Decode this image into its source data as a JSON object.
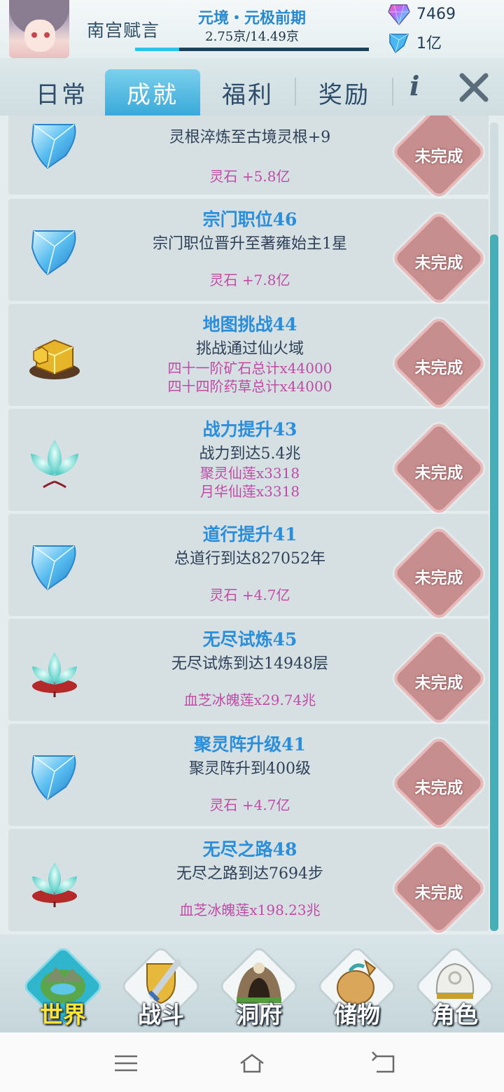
{
  "player": {
    "name": "南宫赋言",
    "realm": "元境・元极前期",
    "progress_text": "2.75京/14.49京",
    "progress_fraction": 0.19
  },
  "currency": {
    "gem": "7469",
    "crystal": "1亿"
  },
  "tabs": [
    {
      "label": "日常"
    },
    {
      "label": "成就"
    },
    {
      "label": "福利"
    },
    {
      "label": "奖励"
    }
  ],
  "info_label": "i",
  "achievements": [
    {
      "title": "",
      "desc": "灵根淬炼至古境灵根+9",
      "rewards": [
        "灵石 +5.8亿"
      ],
      "icon": "spirit-stone-icon",
      "status": "未完成"
    },
    {
      "title": "宗门职位46",
      "desc": "宗门职位晋升至著雍始主1星",
      "rewards": [
        "灵石 +7.8亿"
      ],
      "icon": "spirit-stone-icon",
      "status": "未完成"
    },
    {
      "title": "地图挑战44",
      "desc": "挑战通过仙火域",
      "rewards": [
        "四十一阶矿石总计x44000",
        "四十四阶药草总计x44000"
      ],
      "icon": "gold-ore-icon",
      "status": "未完成"
    },
    {
      "title": "战力提升43",
      "desc": "战力到达5.4兆",
      "rewards": [
        "聚灵仙莲x3318",
        "月华仙莲x3318"
      ],
      "icon": "lotus-icon",
      "status": "未完成"
    },
    {
      "title": "道行提升41",
      "desc": "总道行到达827052年",
      "rewards": [
        "灵石 +4.7亿"
      ],
      "icon": "spirit-stone-icon",
      "status": "未完成"
    },
    {
      "title": "无尽试炼45",
      "desc": "无尽试炼到达14948层",
      "rewards": [
        "血芝冰魄莲x29.74兆"
      ],
      "icon": "ice-lotus-icon",
      "status": "未完成"
    },
    {
      "title": "聚灵阵升级41",
      "desc": "聚灵阵升到400级",
      "rewards": [
        "灵石 +4.7亿"
      ],
      "icon": "spirit-stone-icon",
      "status": "未完成"
    },
    {
      "title": "无尽之路48",
      "desc": "无尽之路到达7694步",
      "rewards": [
        "血芝冰魄莲x198.23兆"
      ],
      "icon": "ice-lotus-icon",
      "status": "未完成"
    }
  ],
  "bottom_nav": [
    {
      "label": "世界",
      "icon": "world-icon"
    },
    {
      "label": "战斗",
      "icon": "sword-shield-icon"
    },
    {
      "label": "洞府",
      "icon": "cave-icon"
    },
    {
      "label": "储物",
      "icon": "bag-icon"
    },
    {
      "label": "角色",
      "icon": "helmet-icon"
    }
  ],
  "colors": {
    "accent": "#2a8edb",
    "reward": "#c04aa6",
    "status_button": "#c78e8f",
    "tab_active": "#3aa9da"
  }
}
